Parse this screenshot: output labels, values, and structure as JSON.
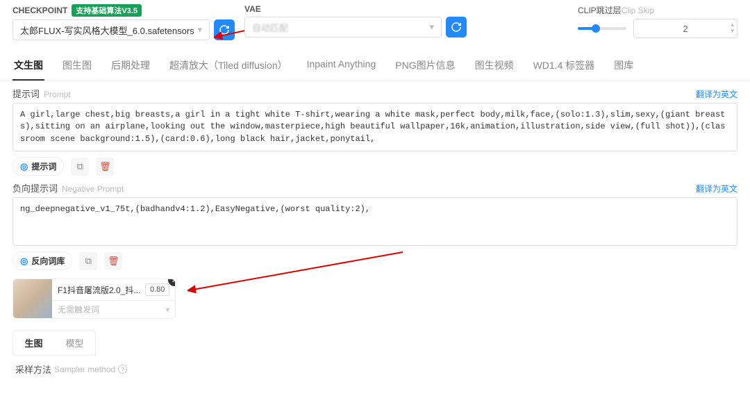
{
  "header": {
    "checkpoint_label": "CHECKPOINT",
    "checkpoint_badge": "支持基础算法V3.5",
    "checkpoint_value": "太郎FLUX-写实风格大模型_6.0.safetensors",
    "vae_label": "VAE",
    "vae_placeholder": "自动匹配",
    "clip_label_zh": "CLIP跳过层",
    "clip_label_en": "Clip Skip",
    "clip_value": "2"
  },
  "tabs": [
    "文生图",
    "图生图",
    "后期处理",
    "超清放大（Tiled diffusion）",
    "Inpaint Anything",
    "PNG图片信息",
    "图生视频",
    "WD1.4 标签器",
    "图库"
  ],
  "active_tab": "文生图",
  "prompt": {
    "label_zh": "提示词",
    "label_en": "Prompt",
    "translate": "翻译为英文",
    "value": "A girl,large chest,big breasts,a girl in a tight white T-shirt,wearing a white mask,perfect body,milk,face,(solo:1.3),slim,sexy,(giant breasts),sitting on an airplane,looking out the window,masterpiece,high beautiful wallpaper,16k,animation,illustration,side view,(full shot)),(classroom scene background:1.5),(card:0.6),long black hair,jacket,ponytail,",
    "token_btn": "提示词"
  },
  "neg_prompt": {
    "label_zh": "负向提示词",
    "label_en": "Negative Prompt",
    "translate": "翻译为英文",
    "value": "ng_deepnegative_v1_75t,(badhandv4:1.2),EasyNegative,(worst quality:2),",
    "token_btn": "反向词库"
  },
  "lora": {
    "name": "F1抖音屠流版2.0_抖...",
    "weight": "0.80",
    "trigger_placeholder": "无需触发词"
  },
  "gen_tabs": {
    "a": "生图",
    "b": "模型"
  },
  "sampler": {
    "zh": "采样方法",
    "en": "Sampler method"
  },
  "icons": {
    "refresh": "↻",
    "chev_down": "▾",
    "copy": "⧉",
    "trash": "🗑",
    "close": "✕",
    "info": "?"
  }
}
